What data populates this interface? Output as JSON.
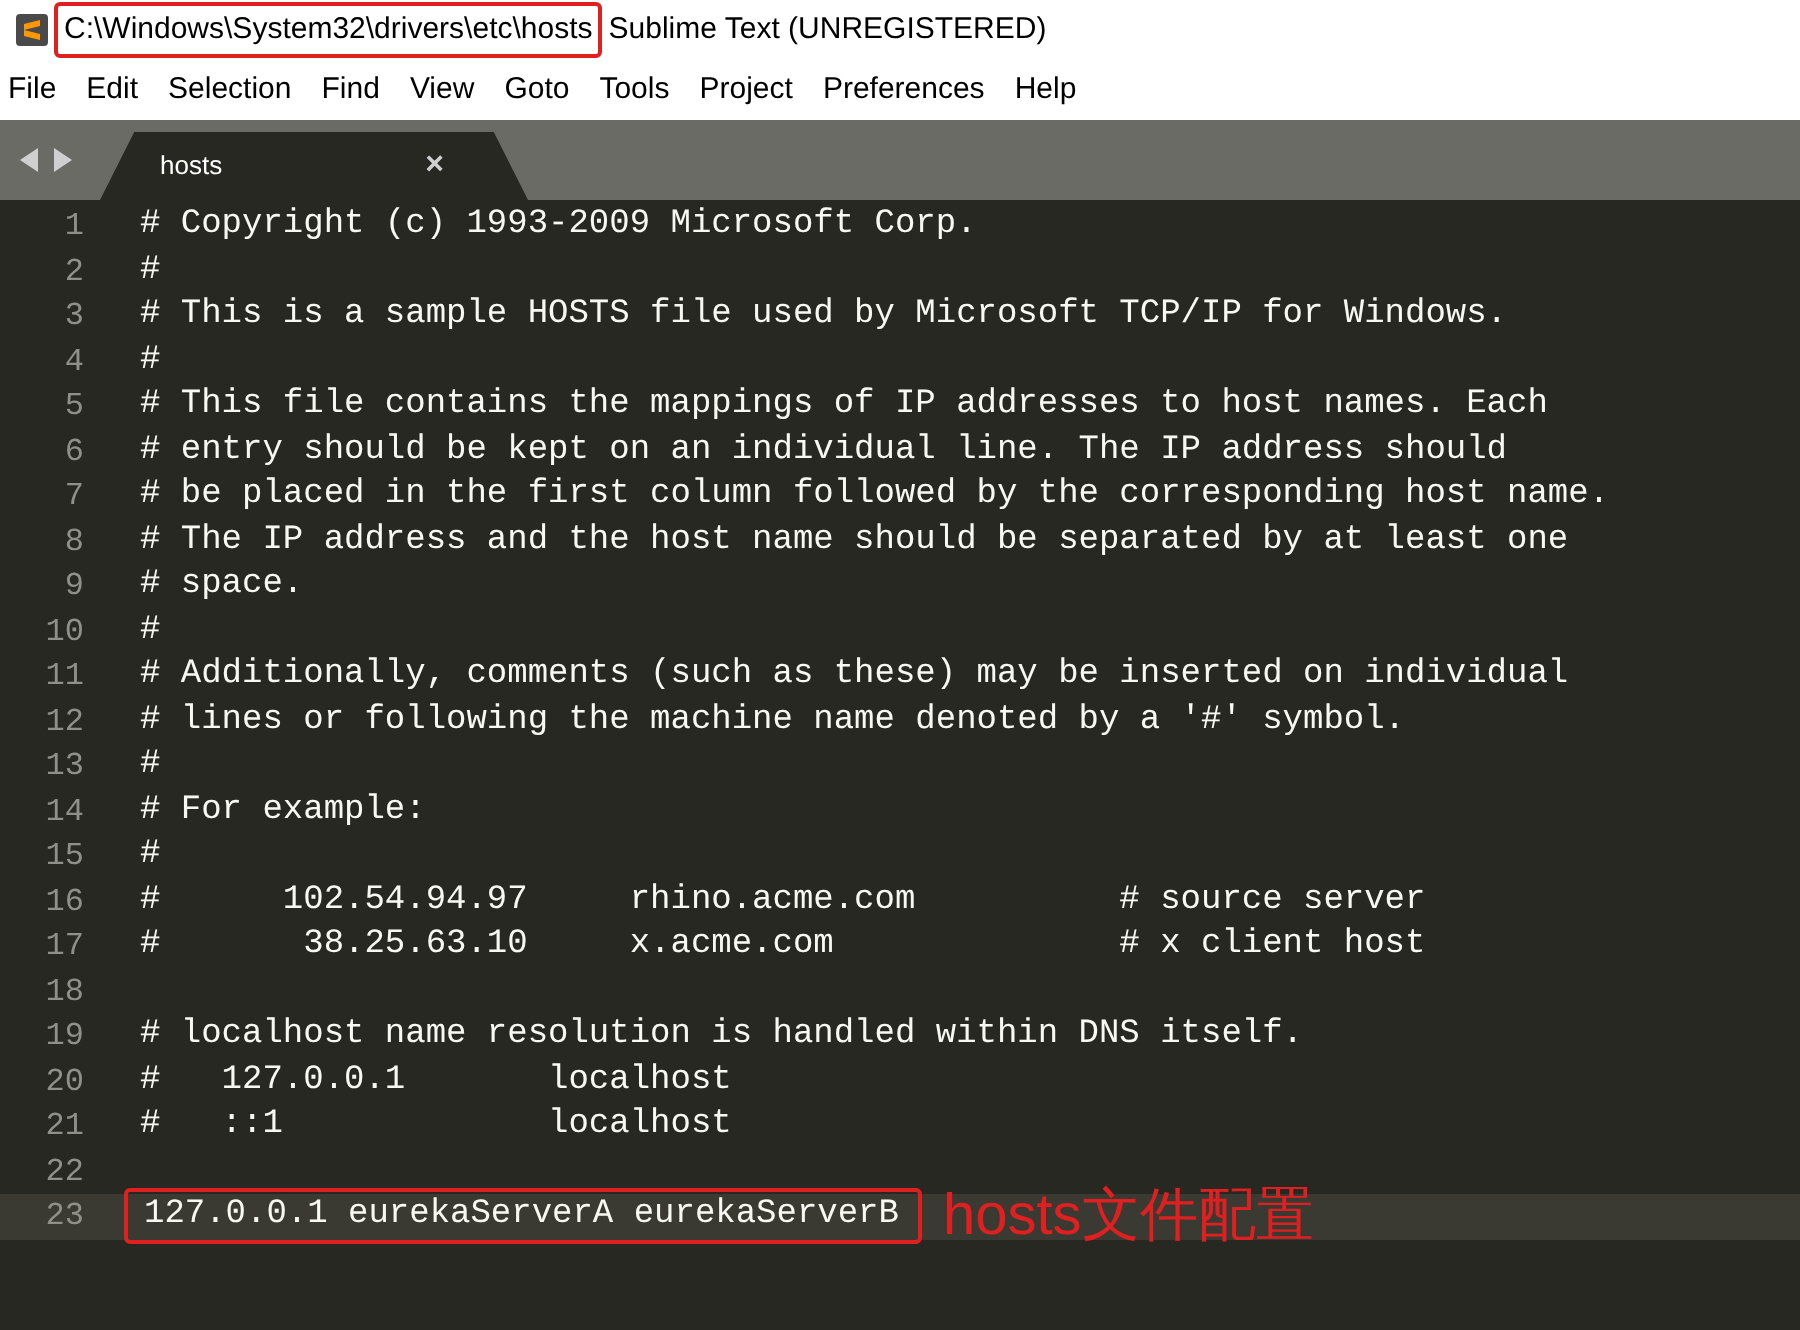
{
  "window": {
    "title_path": "C:\\Windows\\System32\\drivers\\etc\\hosts",
    "title_path_boxed": true,
    "title_app": "Sublime Text (UNREGISTERED)"
  },
  "menu": [
    "File",
    "Edit",
    "Selection",
    "Find",
    "View",
    "Goto",
    "Tools",
    "Project",
    "Preferences",
    "Help"
  ],
  "tabs": [
    {
      "label": "hosts",
      "selected": true,
      "close": "×"
    }
  ],
  "editor": {
    "lines": [
      {
        "number": "1",
        "text": "# Copyright (c) 1993-2009 Microsoft Corp.",
        "current": false
      },
      {
        "number": "2",
        "text": "#",
        "current": false
      },
      {
        "number": "3",
        "text": "# This is a sample HOSTS file used by Microsoft TCP/IP for Windows.",
        "current": false
      },
      {
        "number": "4",
        "text": "#",
        "current": false
      },
      {
        "number": "5",
        "text": "# This file contains the mappings of IP addresses to host names. Each",
        "current": false
      },
      {
        "number": "6",
        "text": "# entry should be kept on an individual line. The IP address should",
        "current": false
      },
      {
        "number": "7",
        "text": "# be placed in the first column followed by the corresponding host name.",
        "current": false
      },
      {
        "number": "8",
        "text": "# The IP address and the host name should be separated by at least one",
        "current": false
      },
      {
        "number": "9",
        "text": "# space.",
        "current": false
      },
      {
        "number": "10",
        "text": "#",
        "current": false
      },
      {
        "number": "11",
        "text": "# Additionally, comments (such as these) may be inserted on individual",
        "current": false
      },
      {
        "number": "12",
        "text": "# lines or following the machine name denoted by a '#' symbol.",
        "current": false
      },
      {
        "number": "13",
        "text": "#",
        "current": false
      },
      {
        "number": "14",
        "text": "# For example:",
        "current": false
      },
      {
        "number": "15",
        "text": "#",
        "current": false
      },
      {
        "number": "16",
        "text": "#      102.54.94.97     rhino.acme.com          # source server",
        "current": false
      },
      {
        "number": "17",
        "text": "#       38.25.63.10     x.acme.com              # x client host",
        "current": false
      },
      {
        "number": "18",
        "current": false
      },
      {
        "number": "19",
        "text": "# localhost name resolution is handled within DNS itself.",
        "current": false
      },
      {
        "number": "20",
        "text": "#   127.0.0.1       localhost",
        "current": false
      },
      {
        "number": "21",
        "text": "#   ::1             localhost",
        "current": false
      },
      {
        "number": "22",
        "current": false
      },
      {
        "number": "23",
        "text": "127.0.0.1 eurekaServerA eurekaServerB",
        "current": true,
        "boxed": true,
        "note": "hosts文件配置"
      }
    ]
  }
}
